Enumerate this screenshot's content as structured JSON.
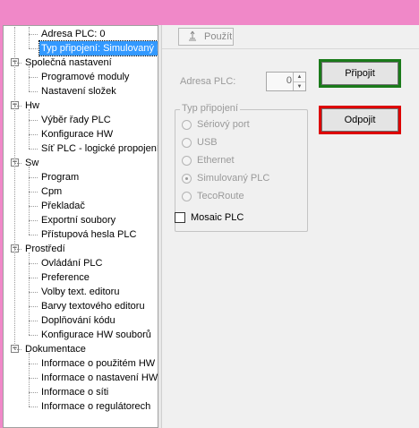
{
  "toolbar": {
    "apply_label": "Použít"
  },
  "tree": [
    {
      "label": "Adresa PLC: 0",
      "level": 1
    },
    {
      "label": "Typ připojení: Simulovaný PLC",
      "level": 1,
      "selected": true
    },
    {
      "label": "Společná nastavení",
      "level": 0
    },
    {
      "label": "Programové moduly",
      "level": 1
    },
    {
      "label": "Nastavení složek",
      "level": 1
    },
    {
      "label": "Hw",
      "level": 0
    },
    {
      "label": "Výběr řady PLC",
      "level": 1
    },
    {
      "label": "Konfigurace HW",
      "level": 1
    },
    {
      "label": "Síť PLC - logické propojení",
      "level": 1
    },
    {
      "label": "Sw",
      "level": 0
    },
    {
      "label": "Program",
      "level": 1
    },
    {
      "label": "Cpm",
      "level": 1
    },
    {
      "label": "Překladač",
      "level": 1
    },
    {
      "label": "Exportní soubory",
      "level": 1
    },
    {
      "label": "Přístupová hesla PLC",
      "level": 1
    },
    {
      "label": "Prostředí",
      "level": 0
    },
    {
      "label": "Ovládání PLC",
      "level": 1
    },
    {
      "label": "Preference",
      "level": 1
    },
    {
      "label": "Volby text. editoru",
      "level": 1
    },
    {
      "label": "Barvy textového editoru",
      "level": 1
    },
    {
      "label": "Doplňování kódu",
      "level": 1
    },
    {
      "label": "Konfigurace HW souborů",
      "level": 1
    },
    {
      "label": "Dokumentace",
      "level": 0
    },
    {
      "label": "Informace o použitém HW",
      "level": 1
    },
    {
      "label": "Informace o nastavení HW",
      "level": 1
    },
    {
      "label": "Informace o síti",
      "level": 1
    },
    {
      "label": "Informace o regulátorech",
      "level": 1
    }
  ],
  "plc_address": {
    "label": "Adresa PLC:",
    "value": "0"
  },
  "buttons": {
    "connect": "Připojit",
    "disconnect": "Odpojit",
    "connect_color": "#1a7a1a",
    "disconnect_color": "#dd0000"
  },
  "connection_type": {
    "title": "Typ připojení",
    "options": [
      {
        "label": "Sériový port",
        "checked": false
      },
      {
        "label": "USB",
        "checked": false
      },
      {
        "label": "Ethernet",
        "checked": false
      },
      {
        "label": "Simulovaný PLC",
        "checked": true
      },
      {
        "label": "TecoRoute",
        "checked": false
      }
    ]
  },
  "mosaic_plc": {
    "label": "Mosaic PLC",
    "checked": false
  }
}
